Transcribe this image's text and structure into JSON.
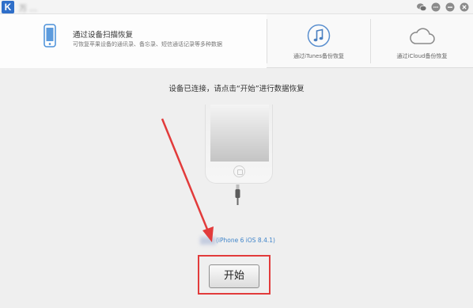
{
  "window": {
    "logo_letter": "K",
    "title": "万 …",
    "title_icons": [
      "wechat-icon",
      "chat-bubble-icon",
      "minimize-icon",
      "close-icon"
    ]
  },
  "tabs": {
    "device_scan": {
      "title": "通过设备扫描恢复",
      "description": "可恢复苹果设备的通讯录、备忘录、短信通话记录等多种数据",
      "icon": "phone-icon"
    },
    "itunes": {
      "caption": "通过iTunes备份恢复",
      "icon": "music-note-icon"
    },
    "icloud": {
      "caption": "通过iCloud备份恢复",
      "icon": "cloud-icon"
    }
  },
  "main": {
    "instruction": "设备已连接，请点击“开始”进行数据恢复",
    "device_label": "(iPhone 6 iOS 8.4.1)",
    "start_button": "开始"
  },
  "colors": {
    "accent_blue": "#3f84c9",
    "annotation_red": "#e23b3b",
    "background": "#efefef"
  }
}
